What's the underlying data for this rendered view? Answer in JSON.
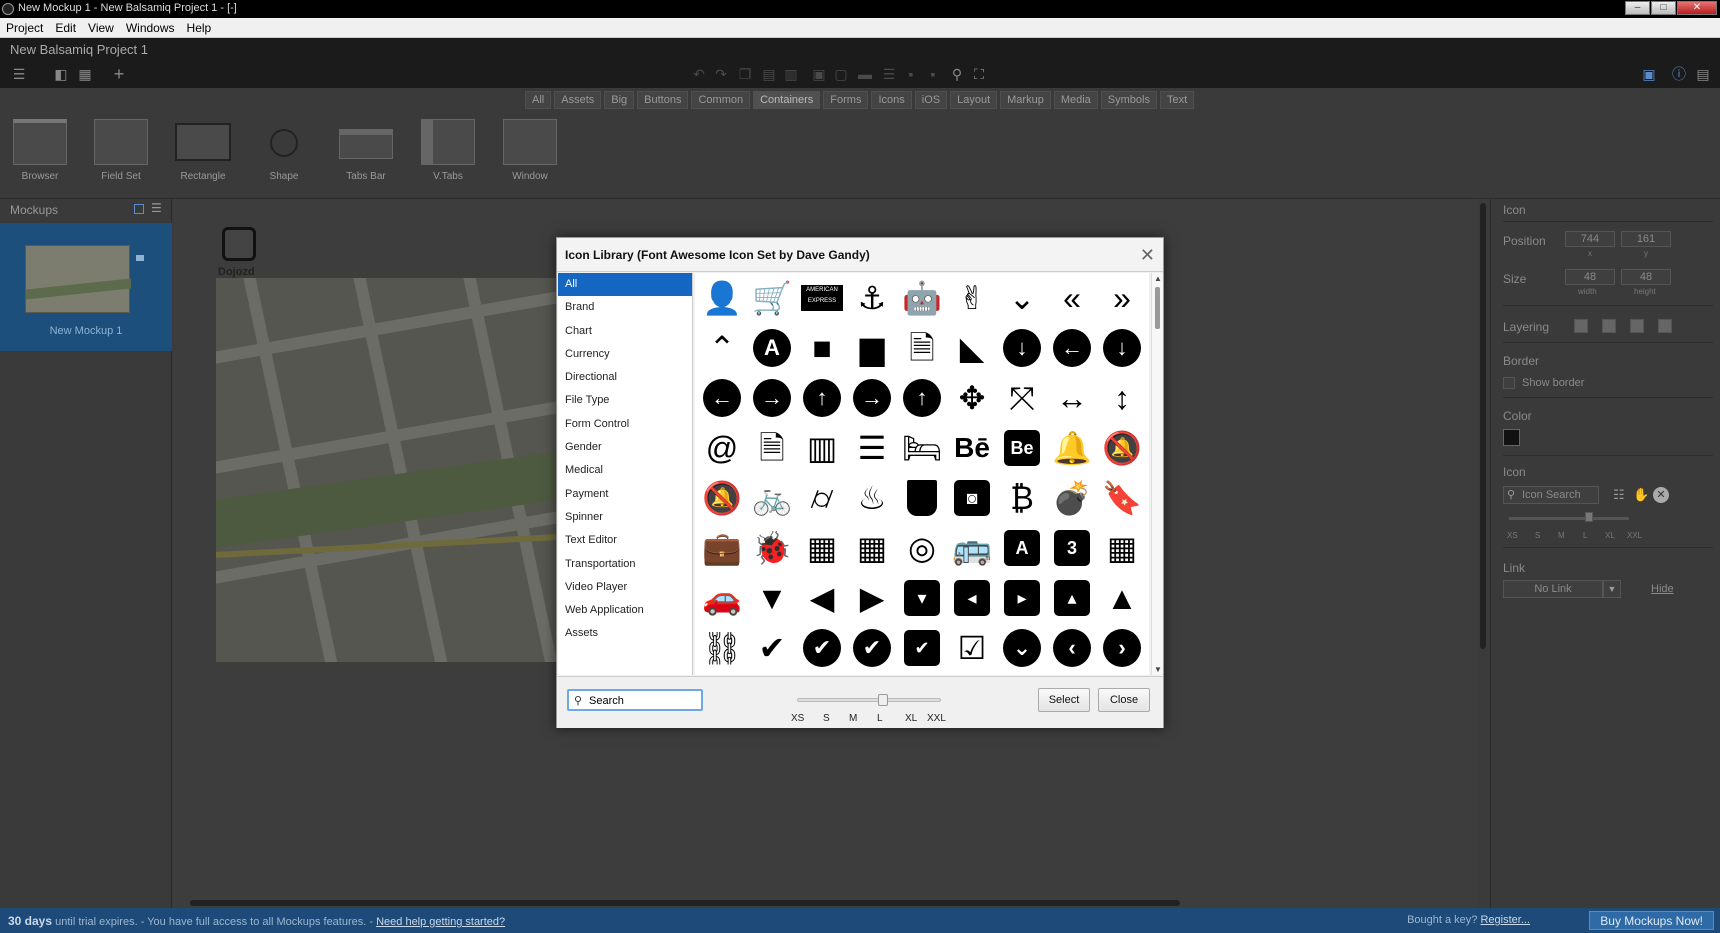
{
  "window": {
    "title": "New Mockup 1 - New Balsamiq Project 1 - [-]",
    "min": "–",
    "max": "□",
    "close": "✕"
  },
  "menu": [
    "Project",
    "Edit",
    "View",
    "Windows",
    "Help"
  ],
  "project": {
    "name": "New Balsamiq Project 1"
  },
  "categories": [
    "All",
    "Assets",
    "Big",
    "Buttons",
    "Common",
    "Containers",
    "Forms",
    "Icons",
    "iOS",
    "Layout",
    "Markup",
    "Media",
    "Symbols",
    "Text"
  ],
  "components": [
    "Browser",
    "Field Set",
    "Rectangle",
    "Shape",
    "Tabs Bar",
    "V.Tabs",
    "Window"
  ],
  "mockups": {
    "title": "Mockups",
    "items": [
      {
        "label": "New Mockup 1"
      }
    ]
  },
  "canvas": {
    "icon_label": "Dojozd"
  },
  "inspector": {
    "title": "Icon",
    "position_label": "Position",
    "x": "744",
    "y": "161",
    "x_sub": "x",
    "y_sub": "y",
    "size_label": "Size",
    "width": "48",
    "height": "48",
    "width_sub": "width",
    "height_sub": "height",
    "layering_label": "Layering",
    "border_label": "Border",
    "show_border": "Show border",
    "color_label": "Color",
    "color": "#111111",
    "icon_label": "Icon",
    "icon_search_placeholder": "Icon Search",
    "sizes": [
      "XS",
      "S",
      "M",
      "L",
      "XL",
      "XXL"
    ],
    "link_label": "Link",
    "link_value": "No Link",
    "hide": "Hide"
  },
  "dialog": {
    "title": "Icon Library (Font Awesome Icon Set by Dave Gandy)",
    "close": "✕",
    "categories": [
      "All",
      "Brand",
      "Chart",
      "Currency",
      "Directional",
      "File Type",
      "Form Control",
      "Gender",
      "Medical",
      "Payment",
      "Spinner",
      "Text Editor",
      "Transportation",
      "Video Player",
      "Web Application",
      "Assets"
    ],
    "selected_category": "All",
    "icons": [
      "user-plus-icon",
      "cart-plus-icon",
      "amex-icon",
      "anchor-icon",
      "android-icon",
      "peace-hand-icon",
      "double-down-icon",
      "double-left-icon",
      "double-right-icon",
      "double-up-icon",
      "adn-icon",
      "apple-icon",
      "archive-icon",
      "file-zip-icon",
      "area-chart-icon",
      "circle-down-icon",
      "circle-left-icon",
      "circle-down-outline-icon",
      "circle-o-left-icon",
      "circle-o-right-icon",
      "circle-o-up-icon",
      "circle-right-icon",
      "circle-up-icon",
      "arrows-icon",
      "expand-icon",
      "arrows-h-icon",
      "arrows-v-icon",
      "at-icon",
      "file-audio-icon",
      "bar-chart-icon",
      "bars-icon",
      "bed-icon",
      "behance-icon",
      "behance-square-icon",
      "bell-o-icon",
      "bell-slash-icon",
      "bell-slash-o-icon",
      "bicycle-icon",
      "binoculars-icon",
      "birthday-cake-icon",
      "bitbucket-icon",
      "bitbucket-square-icon",
      "bitcoin-icon",
      "bomb-icon",
      "bookmark-o-icon",
      "briefcase-icon",
      "bug-icon",
      "building-icon",
      "building-o-icon",
      "bullseye-icon",
      "bus-icon",
      "buysellads-icon",
      "css3-icon",
      "calculator-icon",
      "car-icon",
      "caret-down-icon",
      "caret-left-icon",
      "caret-right-icon",
      "caret-square-down-icon",
      "caret-square-left-icon",
      "caret-square-right-icon",
      "caret-square-up-icon",
      "caret-up-icon",
      "chain-broken-icon",
      "check-icon",
      "check-circle-icon",
      "check-circle-o-icon",
      "check-square-icon",
      "check-square-o-icon",
      "chevron-circle-down-icon",
      "chevron-circle-left-icon",
      "chevron-circle-right-icon"
    ],
    "search_placeholder": "Search",
    "search_value": "Search",
    "sizes": [
      "XS",
      "S",
      "M",
      "L",
      "XL",
      "XXL"
    ],
    "select_button": "Select",
    "close_button": "Close"
  },
  "status": {
    "days": "30 days",
    "trial": " until trial expires. - You have full access to all Mockups features. - ",
    "help_link": "Need help getting started?",
    "key_text": "Bought a key? ",
    "register": "Register...",
    "buy": "Buy Mockups Now!"
  }
}
